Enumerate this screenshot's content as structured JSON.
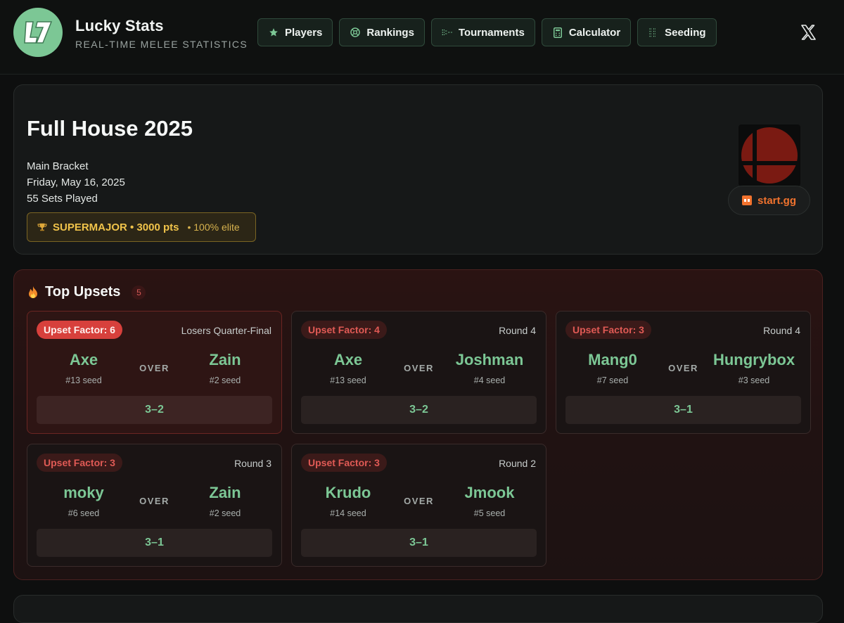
{
  "header": {
    "brand_title": "Lucky Stats",
    "brand_subtitle": "REAL-TIME MELEE STATISTICS",
    "nav": [
      {
        "label": "Players",
        "icon": "star-icon"
      },
      {
        "label": "Rankings",
        "icon": "ranking-icon"
      },
      {
        "label": "Tournaments",
        "icon": "bracket-icon"
      },
      {
        "label": "Calculator",
        "icon": "calculator-icon"
      },
      {
        "label": "Seeding",
        "icon": "seeding-icon"
      }
    ],
    "social_icon": "x-icon"
  },
  "tournament": {
    "name": "Full House 2025",
    "event": "Main Bracket",
    "date": "Friday, May 16, 2025",
    "sets": "55 Sets Played",
    "tier": "SUPERMAJOR • 3000 pts",
    "tier_extra": "• 100% elite",
    "link_label": "start.gg"
  },
  "upsets": {
    "title": "Top Upsets",
    "count": "5",
    "over_label": "OVER",
    "items": [
      {
        "factor": "Upset Factor: 6",
        "round": "Losers Quarter-Final",
        "winner": "Axe",
        "winner_seed": "#13 seed",
        "loser": "Zain",
        "loser_seed": "#2 seed",
        "score": "3–2"
      },
      {
        "factor": "Upset Factor: 4",
        "round": "Round 4",
        "winner": "Axe",
        "winner_seed": "#13 seed",
        "loser": "Joshman",
        "loser_seed": "#4 seed",
        "score": "3–2"
      },
      {
        "factor": "Upset Factor: 3",
        "round": "Round 4",
        "winner": "Mang0",
        "winner_seed": "#7 seed",
        "loser": "Hungrybox",
        "loser_seed": "#3 seed",
        "score": "3–1"
      },
      {
        "factor": "Upset Factor: 3",
        "round": "Round 3",
        "winner": "moky",
        "winner_seed": "#6 seed",
        "loser": "Zain",
        "loser_seed": "#2 seed",
        "score": "3–1"
      },
      {
        "factor": "Upset Factor: 3",
        "round": "Round 2",
        "winner": "Krudo",
        "winner_seed": "#14 seed",
        "loser": "Jmook",
        "loser_seed": "#5 seed",
        "score": "3–1"
      }
    ]
  },
  "colors": {
    "accent_green": "#7cc795",
    "upset_red": "#d7403c",
    "tier_gold": "#f0c34a",
    "startgg_orange": "#f2732e"
  }
}
